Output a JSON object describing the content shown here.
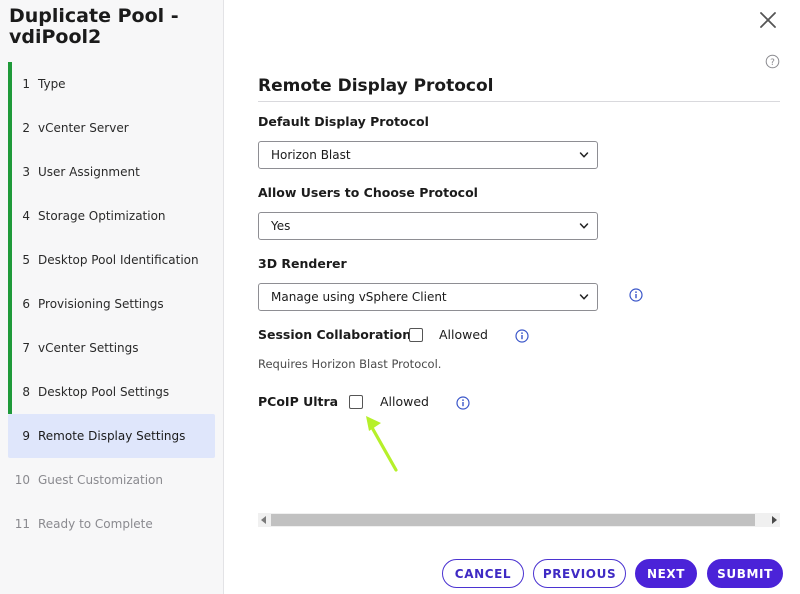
{
  "dialog": {
    "title_line1": "Duplicate Pool -",
    "title_line2": "vdiPool2"
  },
  "steps": [
    {
      "num": "1",
      "label": "Type",
      "state": "done"
    },
    {
      "num": "2",
      "label": "vCenter Server",
      "state": "done"
    },
    {
      "num": "3",
      "label": "User Assignment",
      "state": "done"
    },
    {
      "num": "4",
      "label": "Storage Optimization",
      "state": "done"
    },
    {
      "num": "5",
      "label": "Desktop Pool Identification",
      "state": "done"
    },
    {
      "num": "6",
      "label": "Provisioning Settings",
      "state": "done"
    },
    {
      "num": "7",
      "label": "vCenter Settings",
      "state": "done"
    },
    {
      "num": "8",
      "label": "Desktop Pool Settings",
      "state": "done"
    },
    {
      "num": "9",
      "label": "Remote Display Settings",
      "state": "current"
    },
    {
      "num": "10",
      "label": "Guest Customization",
      "state": "future"
    },
    {
      "num": "11",
      "label": "Ready to Complete",
      "state": "future"
    }
  ],
  "main": {
    "title": "Remote Display Protocol",
    "default_protocol": {
      "label": "Default Display Protocol",
      "value": "Horizon Blast"
    },
    "allow_choose": {
      "label": "Allow Users to Choose Protocol",
      "value": "Yes"
    },
    "renderer": {
      "label": "3D Renderer",
      "value": "Manage using vSphere Client"
    },
    "session_collab": {
      "label": "Session Collaboration",
      "checkbox_label": "Allowed",
      "checked": false
    },
    "note": "Requires Horizon Blast Protocol.",
    "pcoip_ultra": {
      "label": "PCoIP Ultra",
      "checkbox_label": "Allowed",
      "checked": false
    }
  },
  "buttons": {
    "cancel": "CANCEL",
    "previous": "PREVIOUS",
    "next": "NEXT",
    "submit": "SUBMIT"
  },
  "colors": {
    "accent": "#4b23d8",
    "done_bar": "#1f9a3a",
    "current_step_bg": "#dfe6fb",
    "info_icon": "#3a56c9",
    "annotation_arrow": "#b6f02a"
  },
  "icons": {
    "close": "close-icon",
    "help": "help-circle-icon",
    "info": "info-circle-icon",
    "chevron": "chevron-down-icon",
    "annotation": "arrow-annotation-icon"
  }
}
